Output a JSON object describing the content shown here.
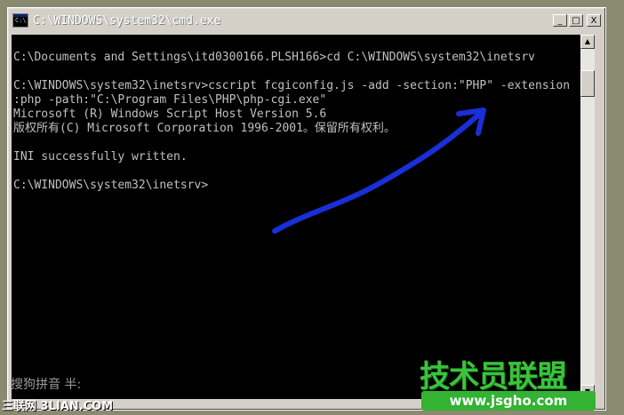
{
  "window": {
    "title": "C:\\WINDOWS\\system32\\cmd.exe",
    "icon": "console-icon",
    "icon_text": "C:\\",
    "minimize_label": "_",
    "maximize_label": "□",
    "close_label": "X"
  },
  "console": {
    "lines": [
      "",
      "C:\\Documents and Settings\\itd0300166.PLSH166>cd C:\\WINDOWS\\system32\\inetsrv",
      "",
      "C:\\WINDOWS\\system32\\inetsrv>cscript fcgiconfig.js -add -section:\"PHP\" -extension",
      ":php -path:\"C:\\Program Files\\PHP\\php-cgi.exe\"",
      "Microsoft (R) Windows Script Host Version 5.6",
      "版权所有(C) Microsoft Corporation 1996-2001。保留所有权利。",
      "",
      "INI successfully written.",
      "",
      "C:\\WINDOWS\\system32\\inetsrv>"
    ],
    "text_color": "#c0c0c0",
    "background": "#000000"
  },
  "scrollbar": {
    "up_arrow": "▲",
    "down_arrow": "▼"
  },
  "ime_status": "搜狗拼音 半:",
  "annotation": {
    "arrow_color": "#1a2fd8"
  },
  "watermarks": {
    "left": "三联网 3LIAN.COM",
    "right_title": "技术员联盟",
    "right_url": "www.jsgho.com"
  }
}
